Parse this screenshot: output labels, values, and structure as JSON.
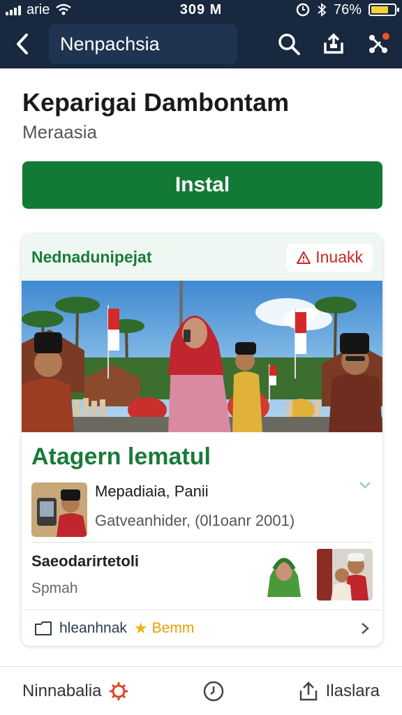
{
  "status": {
    "carrier": "arie",
    "time": "309 M",
    "battery": "76%",
    "battery_level": 0.76
  },
  "topbar": {
    "title": "Nenpachsia"
  },
  "app": {
    "title": "Keparigai Dambontam",
    "developer": "Meraasia",
    "install_label": "Instal"
  },
  "card": {
    "header_title": "Nednadunipejat",
    "report_label": "Inuakk",
    "section_title": "Atagern lematul",
    "item1": {
      "name": "Mepadiaia, Panii",
      "meta": "Gatveanhider, (0l1oanr 2001)"
    },
    "item2": {
      "name": "Saeodarirtetoli",
      "sub": "Spmah"
    },
    "footer": {
      "label": "hleanhnak",
      "rating": "Bemm"
    }
  },
  "bottom_nav": {
    "left_label": "Ninnabalia",
    "right_label": "Ilaslara"
  },
  "colors": {
    "navy": "#17283f",
    "green": "#137a36",
    "report_red": "#d1221f",
    "star": "#f3b500"
  },
  "icons": [
    "back-arrow-icon",
    "search-icon",
    "share-icon",
    "connect-icon",
    "warning-icon",
    "chevron-down-icon",
    "folder-icon",
    "star-icon",
    "chevron-right-icon",
    "bug-icon",
    "clock-icon",
    "upload-icon"
  ]
}
